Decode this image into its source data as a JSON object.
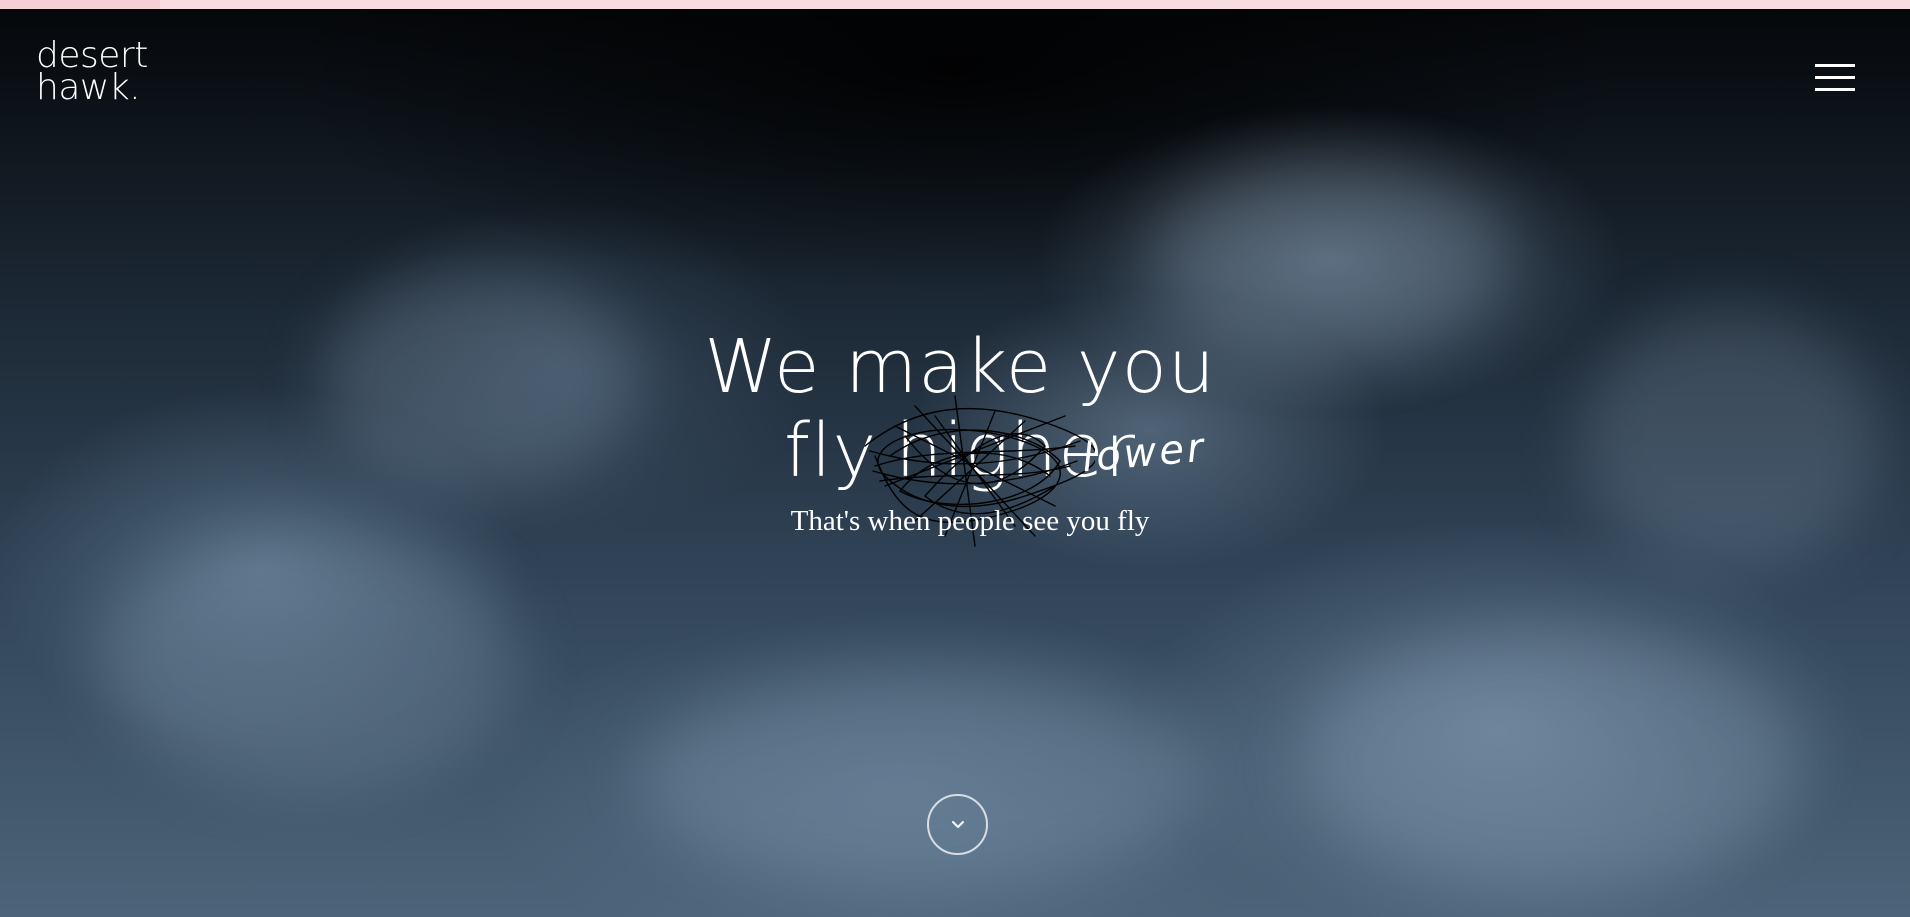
{
  "brand": {
    "logo_line1": "desert",
    "logo_line2": "hawk."
  },
  "header": {
    "menu_icon": "hamburger-menu-icon"
  },
  "hero": {
    "headline_line1": "We make you",
    "headline_fly": "fly",
    "headline_struck_word": "higher",
    "handwritten_replacement": "lower",
    "subline": "That's when people see you fly",
    "scroll_icon": "chevron-down-icon"
  },
  "colors": {
    "top_strip": "#f6cfd6",
    "text": "#ffffff",
    "scribble": "#000000"
  }
}
